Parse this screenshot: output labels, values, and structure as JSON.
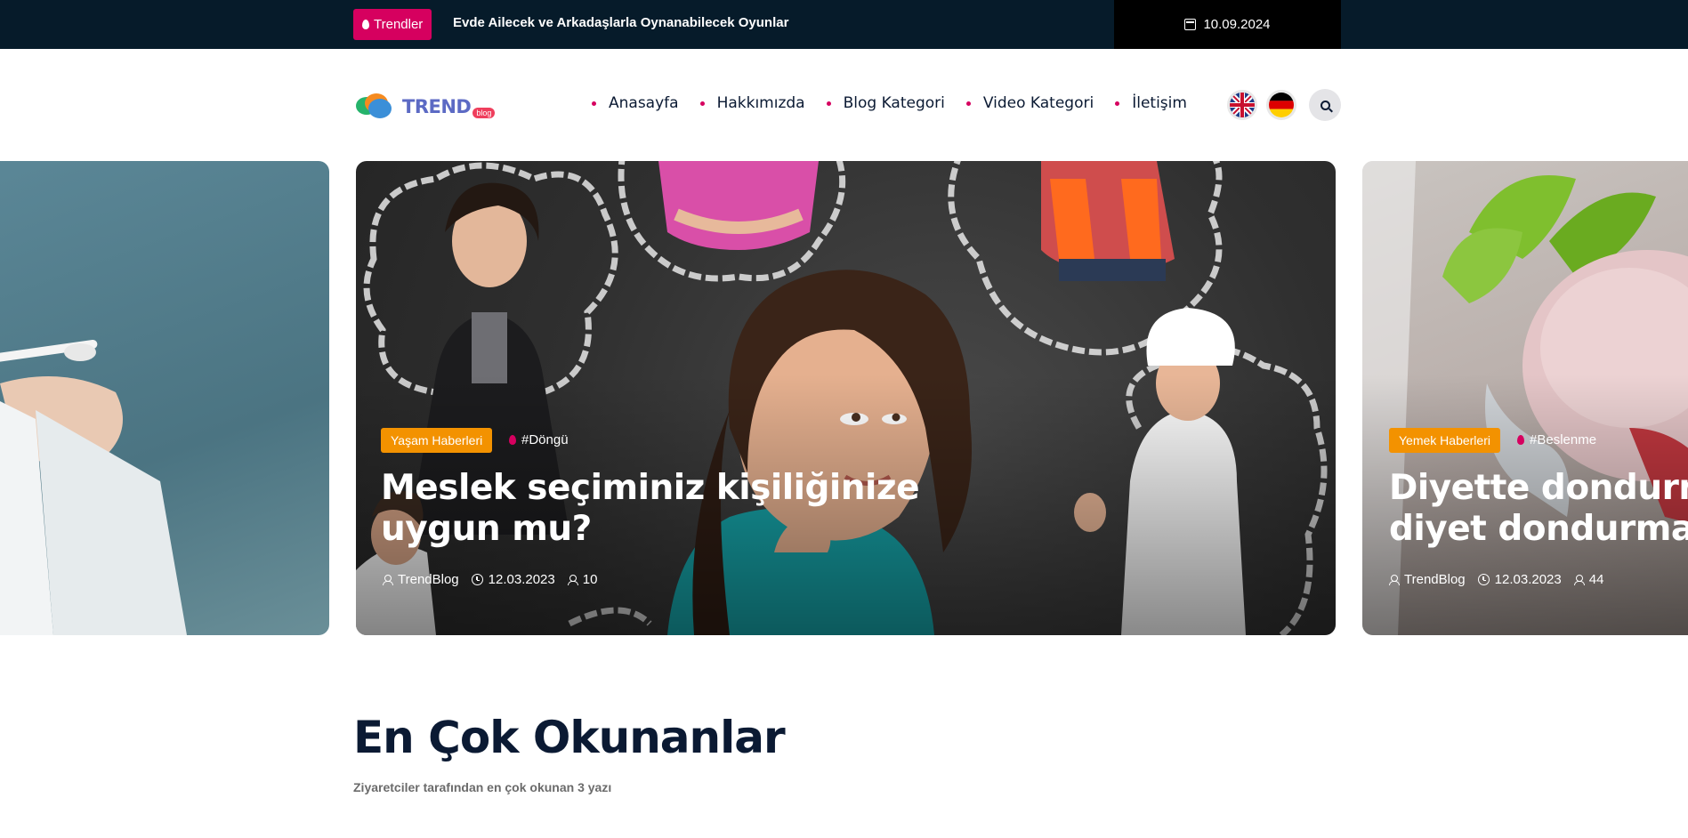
{
  "topbar": {
    "trend_label": "Trendler",
    "ticker_text": "Evde Ailecek ve Arkadaşlarla Oynanabilecek Oyunlar",
    "date": "10.09.2024"
  },
  "header": {
    "logo_text": "TREND",
    "logo_sub": "blog",
    "nav": [
      "Anasayfa",
      "Hakkımızda",
      "Blog Kategori",
      "Video Kategori",
      "İletişim"
    ],
    "languages": [
      "en-flag-icon",
      "de-flag-icon"
    ]
  },
  "slides": {
    "main": {
      "category": "Yaşam Haberleri",
      "tag": "#Döngü",
      "title_line1": "Meslek seçiminiz kişiliğinize",
      "title_line2": "uygun mu?",
      "author": "TrendBlog",
      "date": "12.03.2023",
      "views": "10"
    },
    "right": {
      "category": "Yemek Haberleri",
      "tag": "#Beslenme",
      "title_line1": "Diyette dondurma",
      "title_line2": "diyet dondurma t",
      "author": "TrendBlog",
      "date": "12.03.2023",
      "views": "44"
    }
  },
  "section": {
    "title": "En Çok Okunanlar",
    "subtitle": "Ziyaretciler tarafından en çok okunan 3 yazı"
  },
  "colors": {
    "topbar": "#061b2a",
    "accent": "#d6005f",
    "category": "#f39200",
    "heading": "#0b1a33"
  }
}
